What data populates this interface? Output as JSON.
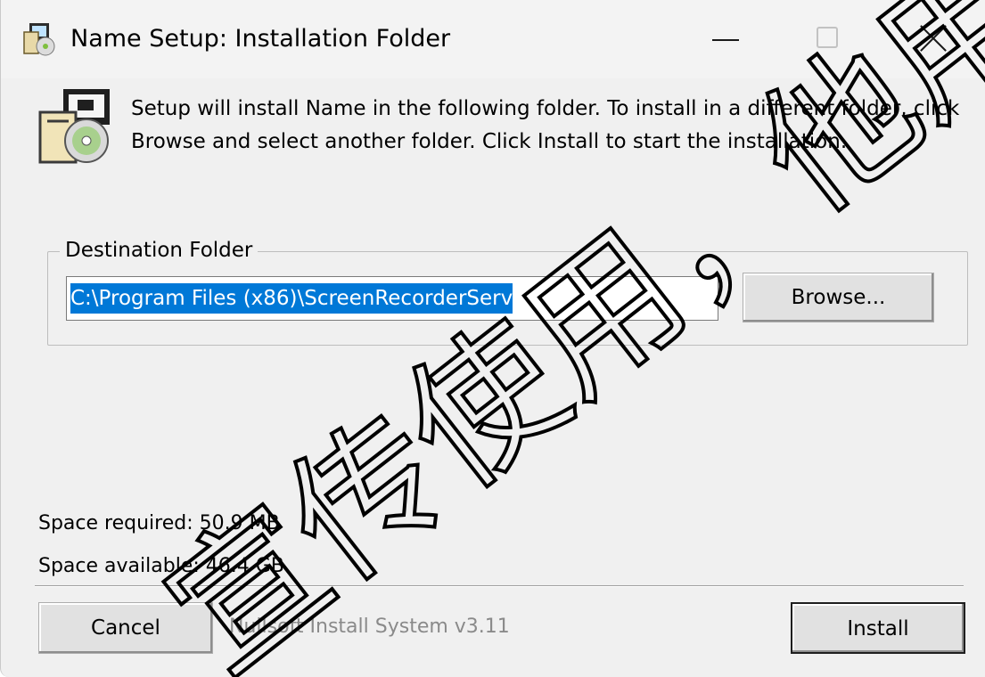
{
  "window": {
    "title": "Name Setup: Installation Folder",
    "controls": [
      "minimize",
      "maximize",
      "close"
    ]
  },
  "header": {
    "text": "Setup will install Name in the following folder. To install in a different folder, click Browse and select another folder. Click Install to start the installation.",
    "icon": "installer-cd-icon"
  },
  "destination": {
    "legend": "Destination Folder",
    "path": "C:\\Program Files (x86)\\ScreenRecorderServ",
    "browse_label": "Browse..."
  },
  "space": {
    "required": "Space required: 50.9 MB",
    "available": "Space available: 46.4 GB"
  },
  "footer": {
    "cancel_label": "Cancel",
    "branding": "Nullsoft Install System v3.11",
    "install_label": "Install"
  },
  "watermark": {
    "text": "宣传使用，他用"
  },
  "colors": {
    "selection": "#0078d7",
    "dialog_background": "#f0f0f0"
  }
}
